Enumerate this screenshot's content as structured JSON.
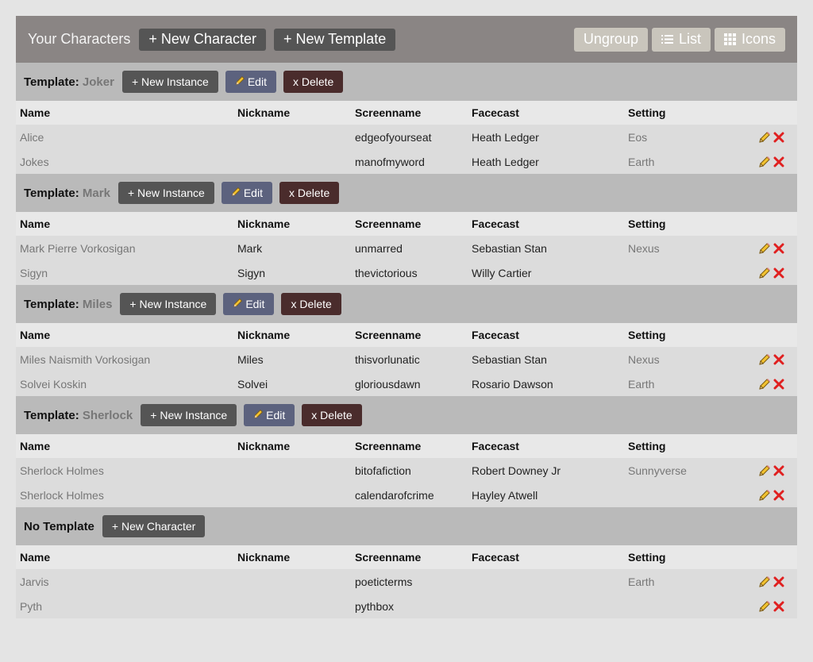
{
  "header": {
    "title": "Your Characters",
    "new_character": "+ New Character",
    "new_template": "+ New Template",
    "ungroup": "Ungroup",
    "list": "List",
    "icons": "Icons"
  },
  "columns": [
    "Name",
    "Nickname",
    "Screenname",
    "Facecast",
    "Setting"
  ],
  "groups": [
    {
      "label": "Template:",
      "name": "Joker",
      "new_instance": "+ New Instance",
      "edit": "Edit",
      "delete": "x Delete",
      "rows": [
        {
          "name": "Alice",
          "nickname": "",
          "screenname": "edgeofyourseat",
          "facecast": "Heath Ledger",
          "setting": "Eos"
        },
        {
          "name": "Jokes",
          "nickname": "",
          "screenname": "manofmyword",
          "facecast": "Heath Ledger",
          "setting": "Earth"
        }
      ]
    },
    {
      "label": "Template:",
      "name": "Mark",
      "new_instance": "+ New Instance",
      "edit": "Edit",
      "delete": "x Delete",
      "rows": [
        {
          "name": "Mark Pierre Vorkosigan",
          "nickname": "Mark",
          "screenname": "unmarred",
          "facecast": "Sebastian Stan",
          "setting": "Nexus"
        },
        {
          "name": "Sigyn",
          "nickname": "Sigyn",
          "screenname": "thevictorious",
          "facecast": "Willy Cartier",
          "setting": ""
        }
      ]
    },
    {
      "label": "Template:",
      "name": "Miles",
      "new_instance": "+ New Instance",
      "edit": "Edit",
      "delete": "x Delete",
      "rows": [
        {
          "name": "Miles Naismith Vorkosigan",
          "nickname": "Miles",
          "screenname": "thisvorlunatic",
          "facecast": "Sebastian Stan",
          "setting": "Nexus"
        },
        {
          "name": "Solvei Koskin",
          "nickname": "Solvei",
          "screenname": "gloriousdawn",
          "facecast": "Rosario Dawson",
          "setting": "Earth"
        }
      ]
    },
    {
      "label": "Template:",
      "name": "Sherlock",
      "new_instance": "+ New Instance",
      "edit": "Edit",
      "delete": "x Delete",
      "rows": [
        {
          "name": "Sherlock Holmes",
          "nickname": "",
          "screenname": "bitofafiction",
          "facecast": "Robert Downey Jr",
          "setting": "Sunnyverse"
        },
        {
          "name": "Sherlock Holmes",
          "nickname": "",
          "screenname": "calendarofcrime",
          "facecast": "Hayley Atwell",
          "setting": ""
        }
      ]
    }
  ],
  "no_template": {
    "label": "No Template",
    "new_character": "+ New Character",
    "rows": [
      {
        "name": "Jarvis",
        "nickname": "",
        "screenname": "poeticterms",
        "facecast": "",
        "setting": "Earth"
      },
      {
        "name": "Pyth",
        "nickname": "",
        "screenname": "pythbox",
        "facecast": "",
        "setting": ""
      }
    ]
  },
  "icons": {
    "edit": "pencil-icon",
    "delete": "red-x-icon",
    "list": "list-icon",
    "grid": "grid-icon"
  },
  "colors": {
    "edit_button": "#5c627e",
    "delete_button": "#4a2c2c",
    "topbar": "#8a8584",
    "delete_x": "#e02020"
  }
}
